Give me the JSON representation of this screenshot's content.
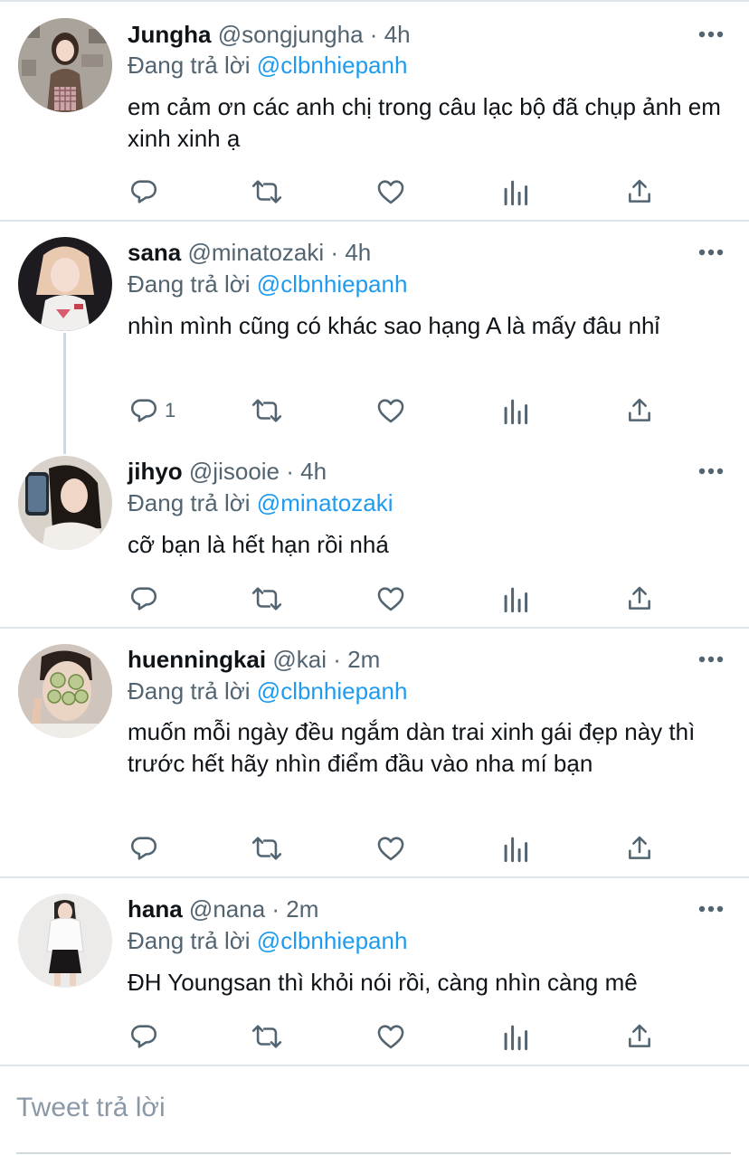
{
  "tweets": [
    {
      "name": "Jungha",
      "handle": "@songjungha",
      "time": "4h",
      "reply_prefix": "Đang trả lời",
      "reply_to": "@clbnhiepanh",
      "text": "em cảm ơn các anh chị trong câu lạc bộ đã chụp ảnh em xinh xinh ạ",
      "reply_count": ""
    },
    {
      "name": "sana",
      "handle": "@minatozaki",
      "time": "4h",
      "reply_prefix": "Đang trả lời",
      "reply_to": "@clbnhiepanh",
      "text": "nhìn mình cũng có khác sao hạng A là mấy đâu nhỉ",
      "reply_count": "1"
    },
    {
      "name": "jihyo",
      "handle": "@jisooie",
      "time": "4h",
      "reply_prefix": "Đang trả lời",
      "reply_to": "@minatozaki",
      "text": "cỡ bạn là hết hạn rồi nhá",
      "reply_count": ""
    },
    {
      "name": "huenningkai",
      "handle": "@kai",
      "time": "2m",
      "reply_prefix": "Đang trả lời",
      "reply_to": "@clbnhiepanh",
      "text": "muốn mỗi ngày đều ngắm dàn trai xinh gái đẹp này thì trước hết hãy nhìn điểm đầu vào nha mí bạn",
      "reply_count": ""
    },
    {
      "name": "hana",
      "handle": "@nana",
      "time": "2m",
      "reply_prefix": "Đang trả lời",
      "reply_to": "@clbnhiepanh",
      "text": "ĐH Youngsan thì khỏi nói rồi, càng nhìn càng mê",
      "reply_count": ""
    }
  ],
  "composer": {
    "placeholder": "Tweet trả lời"
  },
  "colors": {
    "accent": "#1d9bf0",
    "muted": "#536471",
    "text": "#0f1419",
    "divider": "#e1e6ea"
  },
  "icons": [
    "reply-icon",
    "retweet-icon",
    "like-icon",
    "analytics-icon",
    "share-icon",
    "more-icon"
  ]
}
